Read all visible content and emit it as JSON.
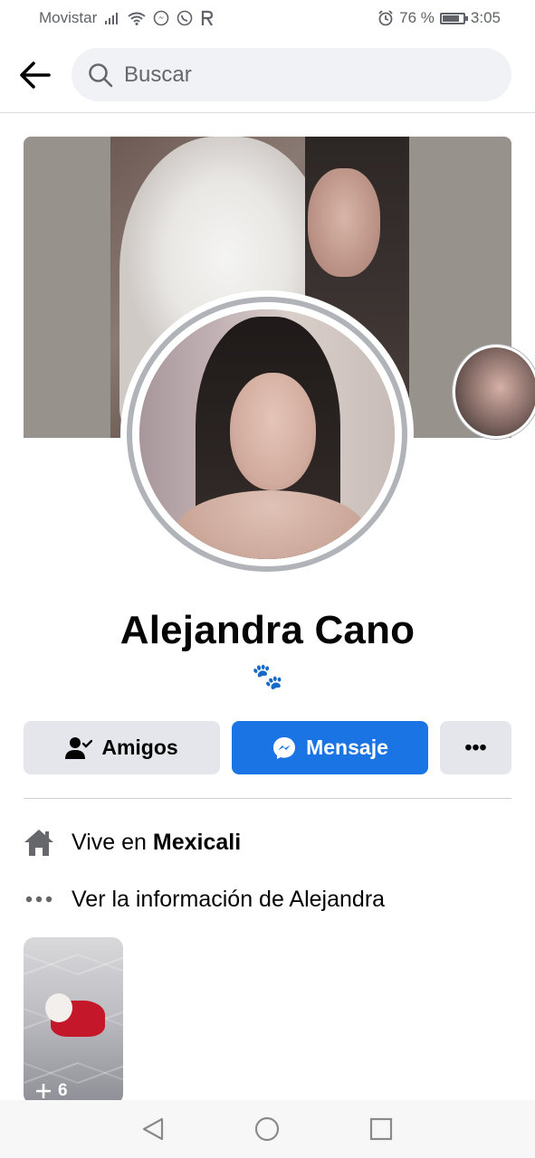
{
  "status_bar": {
    "carrier": "Movistar",
    "battery_text": "76 %",
    "battery_level": 0.76,
    "time": "3:05",
    "icons": [
      "signal-icon",
      "wifi-icon",
      "messenger-icon",
      "whatsapp-icon",
      "app-r-icon",
      "alarm-icon",
      "battery-icon"
    ]
  },
  "header": {
    "back_icon": "arrow-left-icon",
    "search_placeholder": "Buscar"
  },
  "profile": {
    "name": "Alejandra Cano",
    "bio": "🐾"
  },
  "actions": {
    "friends_label": "Amigos",
    "message_label": "Mensaje",
    "more_label": "•••",
    "message_color": "#1b74e4"
  },
  "details": {
    "lives_prefix": "Vive en ",
    "lives_city": "Mexicali",
    "info_label": "Ver la información de Alejandra"
  },
  "photos": {
    "count_label": "6"
  },
  "nav": {
    "icons": [
      "nav-back-icon",
      "nav-home-icon",
      "nav-recent-icon"
    ]
  }
}
